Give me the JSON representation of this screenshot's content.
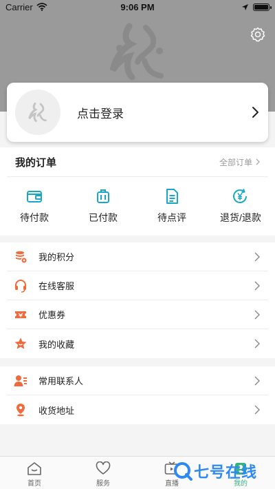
{
  "status_bar": {
    "carrier": "Carrier",
    "time": "9:06 PM",
    "battery_level": 1.0
  },
  "login": {
    "prompt": "点击登录"
  },
  "orders": {
    "title": "我的订单",
    "all_label": "全部订单",
    "items": [
      {
        "label": "待付款",
        "icon": "wallet-icon"
      },
      {
        "label": "已付款",
        "icon": "luggage-icon"
      },
      {
        "label": "待点评",
        "icon": "document-icon"
      },
      {
        "label": "退货/退款",
        "icon": "yen-refund-icon"
      }
    ]
  },
  "menu_group_1": [
    {
      "label": "我的积分",
      "icon": "points-stack-icon"
    },
    {
      "label": "在线客服",
      "icon": "headset-icon"
    },
    {
      "label": "优惠券",
      "icon": "coupon-icon"
    },
    {
      "label": "我的收藏",
      "icon": "star-icon"
    }
  ],
  "menu_group_2": [
    {
      "label": "常用联系人",
      "icon": "contacts-icon"
    },
    {
      "label": "收货地址",
      "icon": "location-pin-icon"
    }
  ],
  "tab_bar": {
    "tabs": [
      {
        "label": "首页",
        "icon": "home-icon"
      },
      {
        "label": "服务",
        "icon": "heart-icon"
      },
      {
        "label": "直播",
        "icon": "tv-icon"
      },
      {
        "label": "我的",
        "icon": "profile-icon"
      }
    ],
    "active_index": 3
  },
  "watermark": {
    "text": "七号在线"
  },
  "colors": {
    "header_background": "#9a9a9a",
    "order_icon": "#19a7c9",
    "menu_icon": "#ef6a3c",
    "active_tab": "#36b37e",
    "watermark": "#2f89f5"
  }
}
